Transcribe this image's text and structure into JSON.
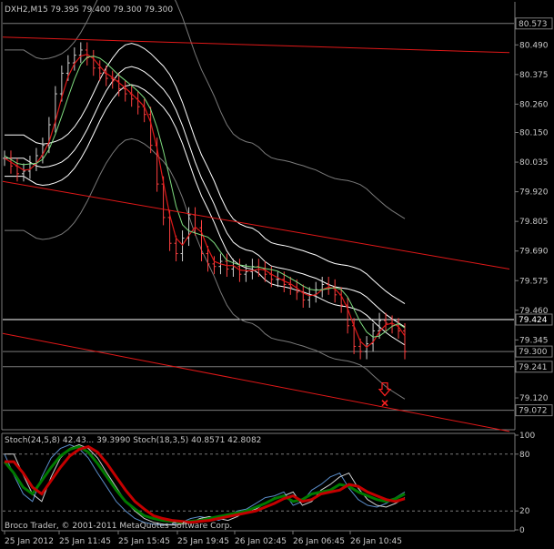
{
  "header": {
    "symbol_line": "DXH2,M15  79.395 79.400 79.300 79.300"
  },
  "colors": {
    "background": "#000000",
    "grid": "#7a7a7a",
    "axis_text": "#c8c8c8",
    "bull_bar": "#cfcfcf",
    "bear_bar": "#ff4040",
    "ma_red": "#e01818",
    "envelope_white": "#ffffff",
    "envelope_gray": "#7a7a7a",
    "trend_red": "#e01818",
    "stoch_red": "#c40000",
    "stoch_green": "#007a00",
    "stoch_light": "#d0d0d0",
    "stoch_blue": "#5a8cc8",
    "marker": "#ff2020"
  },
  "chart_data": [
    {
      "type": "line",
      "title": "DXH2,M15",
      "ohlc_last": {
        "open": 79.395,
        "high": 79.4,
        "low": 79.3,
        "close": 79.3
      },
      "ylim": [
        79.0,
        80.65
      ],
      "y_ticks": [
        "80.490",
        "80.375",
        "80.260",
        "80.150",
        "80.035",
        "79.920",
        "79.805",
        "79.690",
        "79.575",
        "79.460",
        "79.345",
        "79.230",
        "79.120"
      ],
      "price_labels": [
        {
          "text": "80.573",
          "value": 80.573
        },
        {
          "text": "79.424",
          "value": 79.424
        },
        {
          "text": "79.300",
          "value": 79.3
        },
        {
          "text": "79.241",
          "value": 79.241
        },
        {
          "text": "79.072",
          "value": 79.072
        }
      ],
      "horizontal_lines": [
        80.573,
        79.424,
        79.3,
        79.241,
        79.072
      ],
      "x_ticks": [
        "25 Jan 2012",
        "25 Jan 11:45",
        "25 Jan 15:45",
        "25 Jan 19:45",
        "26 Jan 02:45",
        "26 Jan 06:45",
        "26 Jan 10:45"
      ],
      "close_series": [
        80.05,
        80.02,
        79.99,
        80.0,
        80.03,
        80.06,
        80.1,
        80.18,
        80.3,
        80.38,
        80.42,
        80.45,
        80.47,
        80.44,
        80.4,
        80.38,
        80.36,
        80.35,
        80.32,
        80.3,
        80.28,
        80.25,
        80.22,
        80.1,
        79.95,
        79.82,
        79.72,
        79.68,
        79.74,
        79.83,
        79.78,
        79.68,
        79.64,
        79.63,
        79.65,
        79.62,
        79.63,
        79.6,
        79.61,
        79.63,
        79.62,
        79.6,
        79.58,
        79.58,
        79.56,
        79.55,
        79.53,
        79.5,
        79.52,
        79.54,
        79.56,
        79.55,
        79.52,
        79.48,
        79.4,
        79.32,
        79.3,
        79.33,
        79.38,
        79.42,
        79.41,
        79.4,
        79.38,
        79.3
      ],
      "trend_lines": [
        {
          "name": "resistance",
          "from": 80.52,
          "to": 80.46
        },
        {
          "name": "mid",
          "from": 79.96,
          "to": 79.62
        },
        {
          "name": "support",
          "from": 79.37,
          "to": 78.99
        }
      ],
      "annotations": [
        {
          "type": "sell-arrow",
          "value": 79.15
        },
        {
          "type": "cross",
          "value": 79.1
        }
      ]
    },
    {
      "type": "line",
      "title": "Stoch(24,5,8) 42.43... 39.3990  Stoch(18,3,5) 40.8571 42.8082",
      "ylim": [
        0,
        100
      ],
      "y_ticks": [
        "100",
        "80",
        "20",
        "0"
      ],
      "series": [
        {
          "name": "Stoch(24,5,8)",
          "values": [
            72,
            60,
            45,
            38,
            52,
            66,
            78,
            85,
            88,
            82,
            70,
            56,
            42,
            30,
            22,
            15,
            12,
            10,
            9,
            8,
            9,
            10,
            12,
            14,
            16,
            18,
            20,
            24,
            28,
            33,
            36,
            30,
            32,
            38,
            40,
            42,
            48,
            46,
            40,
            36,
            32,
            30,
            33,
            38
          ]
        },
        {
          "name": "Stoch(18,3,5)",
          "values": [
            80,
            58,
            38,
            30,
            56,
            76,
            86,
            90,
            86,
            76,
            60,
            45,
            30,
            20,
            12,
            8,
            6,
            5,
            6,
            8,
            12,
            14,
            12,
            10,
            14,
            20,
            22,
            28,
            34,
            36,
            40,
            26,
            30,
            42,
            48,
            56,
            60,
            44,
            32,
            26,
            24,
            28,
            34,
            40
          ]
        }
      ]
    }
  ],
  "footer": {
    "copyright": "Broco Trader, © 2001-2011 MetaQuotes Software Corp."
  }
}
